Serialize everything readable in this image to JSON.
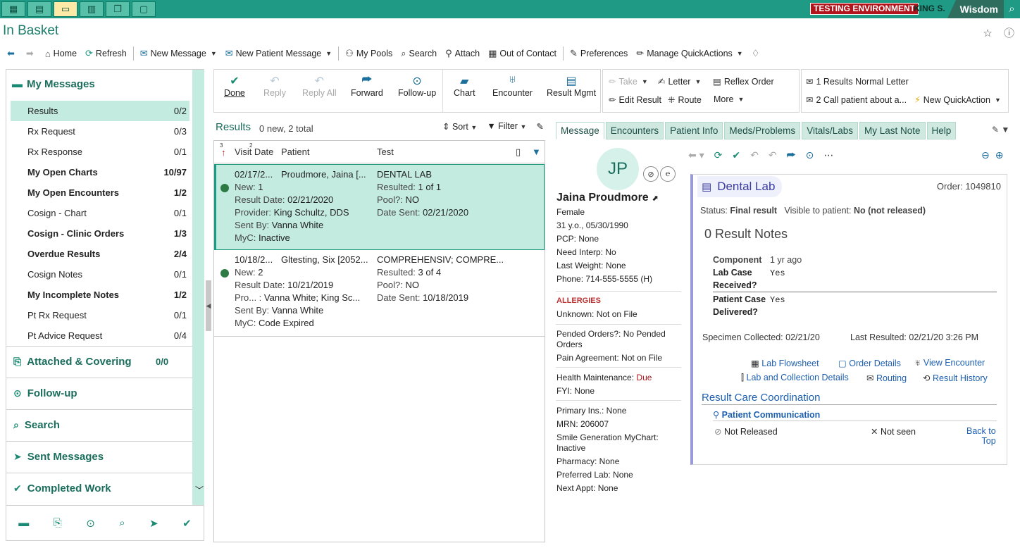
{
  "topbar": {
    "tabs": [
      "dashboard-icon",
      "calendar-icon",
      "inbasket-icon",
      "reports-icon",
      "windows-icon",
      "chat-icon"
    ],
    "environment": "TESTING ENVIRONMENT",
    "user": "KING S.",
    "brand": "Wisdom"
  },
  "page": {
    "title": "In Basket"
  },
  "toolbar": {
    "home": "Home",
    "refresh": "Refresh",
    "new_message": "New Message",
    "new_patient_message": "New Patient Message",
    "my_pools": "My Pools",
    "search": "Search",
    "attach": "Attach",
    "out_of_contact": "Out of Contact",
    "preferences": "Preferences",
    "manage_quickactions": "Manage QuickActions"
  },
  "left": {
    "header": "My Messages",
    "items": [
      {
        "label": "Results",
        "count": "0/2",
        "bold": false,
        "selected": true
      },
      {
        "label": "Rx Request",
        "count": "0/3",
        "bold": false
      },
      {
        "label": "Rx Response",
        "count": "0/1",
        "bold": false
      },
      {
        "label": "My Open Charts",
        "count": "10/97",
        "bold": true
      },
      {
        "label": "My Open Encounters",
        "count": "1/2",
        "bold": true
      },
      {
        "label": "Cosign - Chart",
        "count": "0/1",
        "bold": false
      },
      {
        "label": "Cosign - Clinic Orders",
        "count": "1/3",
        "bold": true
      },
      {
        "label": "Overdue Results",
        "count": "2/4",
        "bold": true
      },
      {
        "label": "Cosign Notes",
        "count": "0/1",
        "bold": false
      },
      {
        "label": "My Incomplete Notes",
        "count": "1/2",
        "bold": true
      },
      {
        "label": "Pt Rx Request",
        "count": "0/1",
        "bold": false
      },
      {
        "label": "Pt Advice Request",
        "count": "0/4",
        "bold": false
      }
    ],
    "sections": {
      "attached": "Attached & Covering",
      "attached_count": "0/0",
      "followup": "Follow-up",
      "search": "Search",
      "sent": "Sent Messages",
      "completed": "Completed Work"
    }
  },
  "actions": {
    "done": "Done",
    "reply": "Reply",
    "reply_all": "Reply All",
    "forward": "Forward",
    "followup": "Follow-up",
    "chart": "Chart",
    "encounter": "Encounter",
    "result_mgmt": "Result Mgmt",
    "take": "Take",
    "letter": "Letter",
    "reflex_order": "Reflex Order",
    "edit_result": "Edit Result",
    "route": "Route",
    "more": "More",
    "qa1": "1 Results Normal Letter",
    "qa2": "2 Call patient about a...",
    "new_quickaction": "New QuickAction"
  },
  "results": {
    "title": "Results",
    "summary": "0 new, 2 total",
    "sort": "Sort",
    "filter": "Filter",
    "sort_badge_1": "3",
    "sort_badge_2": "2",
    "columns": {
      "visit_date": "Visit Date",
      "patient": "Patient",
      "test": "Test"
    },
    "labels": {
      "new": "New:",
      "result_date": "Result Date:",
      "provider": "Provider:",
      "pro": "Pro... :",
      "sent_by": "Sent By:",
      "myc": "MyC:",
      "resulted": "Resulted:",
      "pool": "Pool?:",
      "date_sent": "Date Sent:"
    },
    "rows": [
      {
        "visit": "02/17/2...",
        "patient": "Proudmore, Jaina [...",
        "test": "DENTAL LAB",
        "new": "1",
        "result_date": "02/21/2020",
        "provider": "King Schultz, DDS",
        "sent_by": "Vanna White",
        "myc": "Inactive",
        "resulted": "1 of 1",
        "pool": "NO",
        "date_sent": "02/21/2020"
      },
      {
        "visit": "10/18/2...",
        "patient": "Gltesting, Six [2052...",
        "test": "COMPREHENSIV; COMPRE...",
        "new": "2",
        "result_date": "10/21/2019",
        "provider": "Vanna White; King Sc...",
        "sent_by": "Vanna White",
        "myc": "Code Expired",
        "resulted": "3 of 4",
        "pool": "NO",
        "date_sent": "10/18/2019"
      }
    ]
  },
  "tabs": [
    "Message",
    "Encounters",
    "Patient Info",
    "Meds/Problems",
    "Vitals/Labs",
    "My Last Note",
    "Help"
  ],
  "patient": {
    "initials": "JP",
    "name": "Jaina Proudmore",
    "sex": "Female",
    "age_dob": "31 y.o., 05/30/1990",
    "pcp": "PCP: None",
    "interp": "Need Interp: No",
    "weight": "Last Weight: None",
    "phone": "Phone: 714-555-5555 (H)",
    "allergies_title": "ALLERGIES",
    "allergies": "Unknown: Not on File",
    "pended_1": "Pended Orders?: No Pended",
    "pended_2": "Orders",
    "pain": "Pain Agreement: Not on File",
    "hm_label": "Health Maintenance:",
    "hm_value": "Due",
    "fyi": "FYI: None",
    "primary_ins": "Primary Ins.: None",
    "mrn": "MRN: 206007",
    "mychart_1": "Smile Generation MyChart:",
    "mychart_2": "Inactive",
    "pharmacy": "Pharmacy: None",
    "pref_lab": "Preferred Lab: None",
    "next_appt": "Next Appt: None"
  },
  "detail": {
    "title": "Dental Lab",
    "order": "Order: 1049810",
    "status_label": "Status:",
    "status": "Final result",
    "visible_label": "Visible to patient:",
    "visible": "No (not released)",
    "result_notes": "0  Result Notes",
    "component": "Component",
    "ago": "1 yr ago",
    "c1_a": "Lab Case",
    "c1_b": "Received?",
    "c1_val": "Yes",
    "c2_a": "Patient Case",
    "c2_b": "Delivered?",
    "c2_val": "Yes",
    "specimen": "Specimen Collected: 02/21/20",
    "last_resulted": "Last Resulted: 02/21/20  3:26 PM",
    "lab_flowsheet": "Lab Flowsheet",
    "order_details": "Order Details",
    "view_encounter": "View Encounter",
    "lab_collection": "Lab and Collection Details",
    "routing": "Routing",
    "result_history": "Result History",
    "care_coord": "Result Care Coordination",
    "patient_comm": "Patient Communication",
    "not_released": "Not Released",
    "not_seen": "Not seen",
    "back_to_top_1": "Back to",
    "back_to_top_2": "Top"
  }
}
